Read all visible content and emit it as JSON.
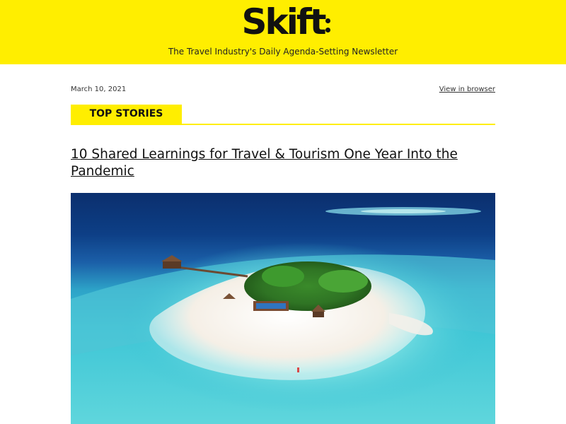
{
  "header": {
    "logo_text": "Skift",
    "tagline": "The Travel Industry's Daily Agenda-Setting Newsletter",
    "background_color": "#ffee00"
  },
  "meta": {
    "date": "March 10, 2021",
    "view_in_browser": "View in browser"
  },
  "section": {
    "label": "TOP STORIES"
  },
  "story": {
    "headline": "10 Shared Learnings for Travel & Tourism One Year Into the Pandemic",
    "image_icon": "tropical-island-photo"
  }
}
